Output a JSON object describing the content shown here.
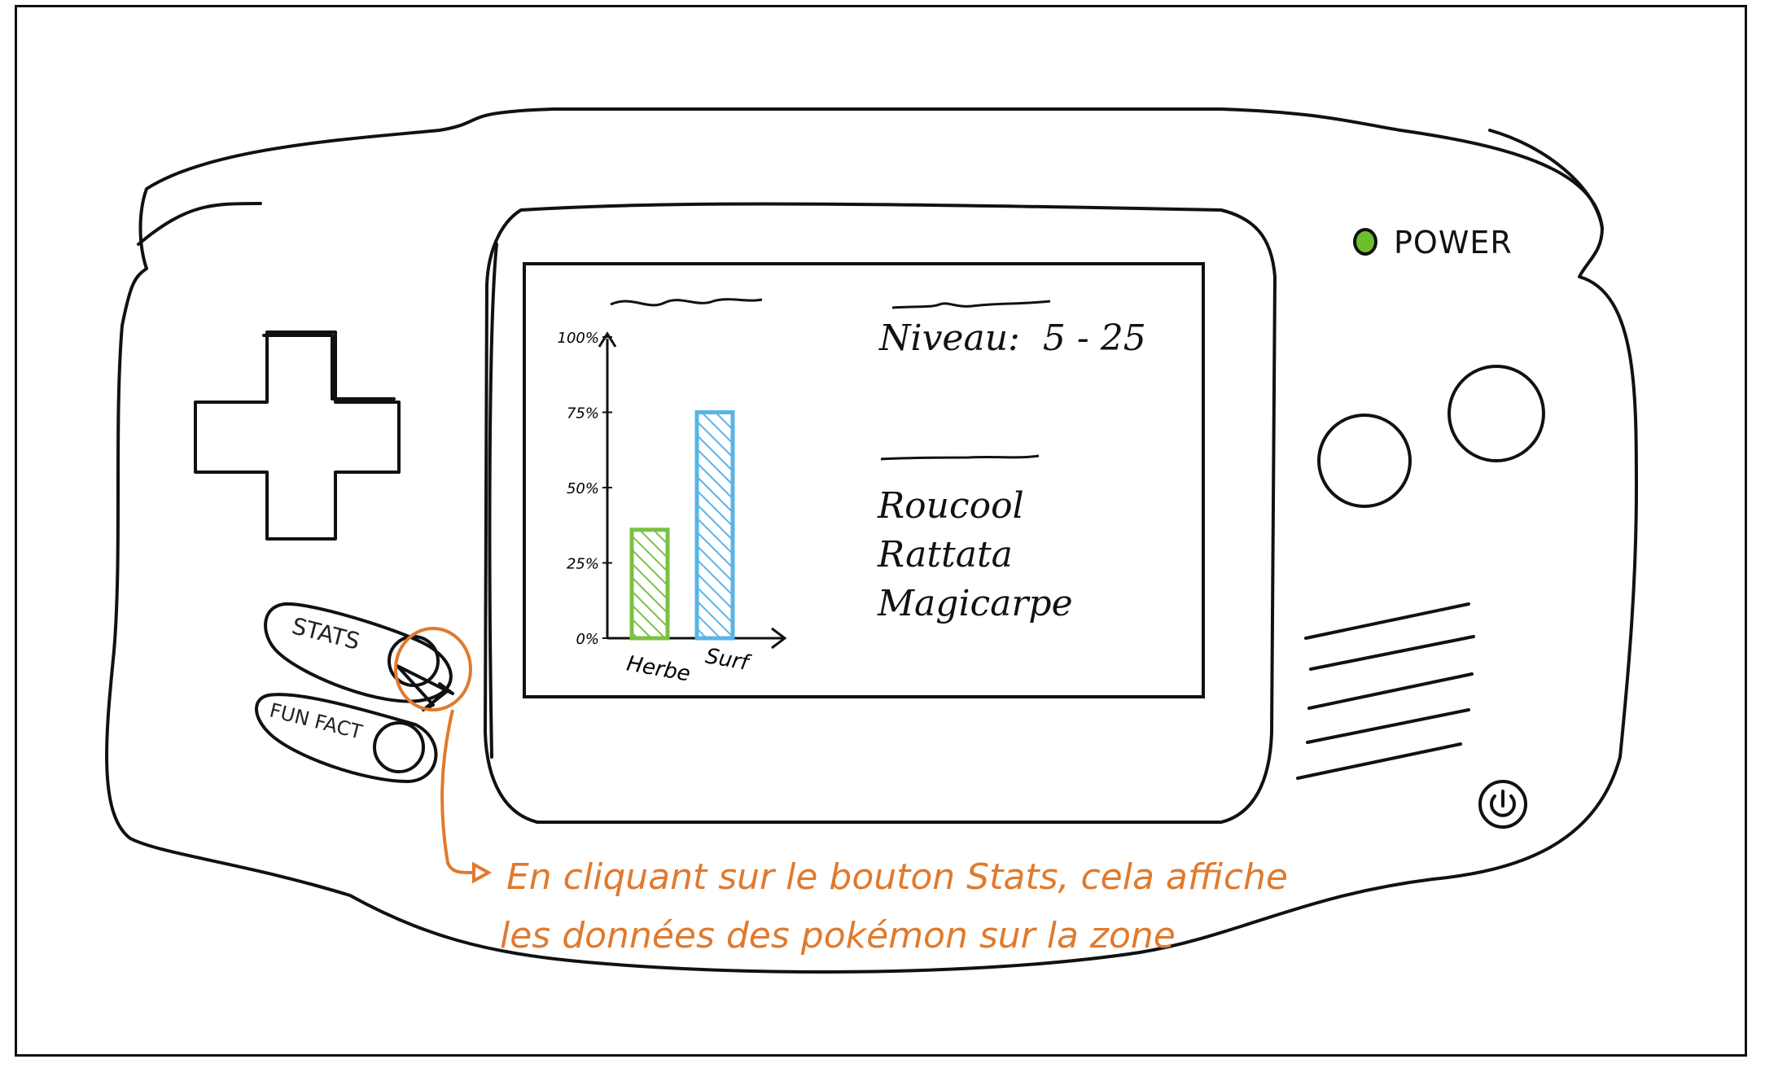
{
  "console": {
    "power_label": "POWER",
    "power_led_color": "#6cbf2a"
  },
  "buttons": {
    "stats_label": "STATS",
    "funfact_label": "FUN FACT"
  },
  "screen": {
    "level_label": "Niveau:",
    "level_range": "5 - 25",
    "pokemon": [
      "Roucool",
      "Rattata",
      "Magicarpe"
    ]
  },
  "chart_data": {
    "type": "bar",
    "categories": [
      "Herbe",
      "Surf"
    ],
    "values": [
      36,
      75
    ],
    "ylim": [
      0,
      100
    ],
    "yticks": [
      "0%",
      "25%",
      "50%",
      "75%",
      "100%"
    ],
    "colors": [
      "#7ac143",
      "#5ab4e6"
    ]
  },
  "annotation": {
    "line1": "En cliquant sur le bouton Stats, cela affiche",
    "line2": "les données des pokémon sur la zone",
    "color": "#e07a2d"
  }
}
